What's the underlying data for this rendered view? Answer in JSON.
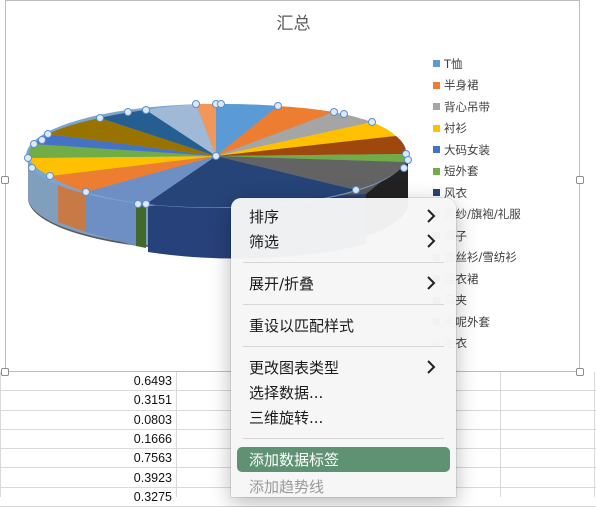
{
  "chart": {
    "title": "汇总",
    "legend": [
      {
        "label": "T恤",
        "color": "#5b9bd5"
      },
      {
        "label": "半身裙",
        "color": "#ed7d31"
      },
      {
        "label": "背心吊带",
        "color": "#a5a5a5"
      },
      {
        "label": "衬衫",
        "color": "#ffc000"
      },
      {
        "label": "大码女装",
        "color": "#4472c4"
      },
      {
        "label": "短外套",
        "color": "#70ad47"
      },
      {
        "label": "风衣",
        "color": "#264478"
      },
      {
        "label": "婚纱/旗袍/礼服",
        "color": "#9e480e"
      },
      {
        "label": "裤子",
        "color": "#636363"
      },
      {
        "label": "蕾丝衫/雪纺衫",
        "color": "#997300"
      },
      {
        "label": "连衣裙",
        "color": "#255e91"
      },
      {
        "label": "马夹",
        "color": "#43682b"
      },
      {
        "label": "毛呢外套",
        "color": "#698ed0"
      },
      {
        "label": "毛衣",
        "color": "#f1975a"
      }
    ]
  },
  "sheet": {
    "values": [
      "0.6493",
      "0.3151",
      "0.0803",
      "0.1666",
      "0.7563",
      "0.3923",
      "0.3275"
    ]
  },
  "context_menu": {
    "items": [
      {
        "label": "排序",
        "submenu": true
      },
      {
        "label": "筛选",
        "submenu": true
      },
      {
        "label": "展开/折叠",
        "submenu": true
      },
      {
        "label": "重设以匹配样式",
        "submenu": false
      },
      {
        "label": "更改图表类型",
        "submenu": true
      },
      {
        "label": "选择数据...",
        "submenu": false
      },
      {
        "label": "三维旋转...",
        "submenu": false
      },
      {
        "label": "添加数据标签",
        "submenu": false
      },
      {
        "label": "添加趋势线",
        "submenu": false
      }
    ]
  }
}
